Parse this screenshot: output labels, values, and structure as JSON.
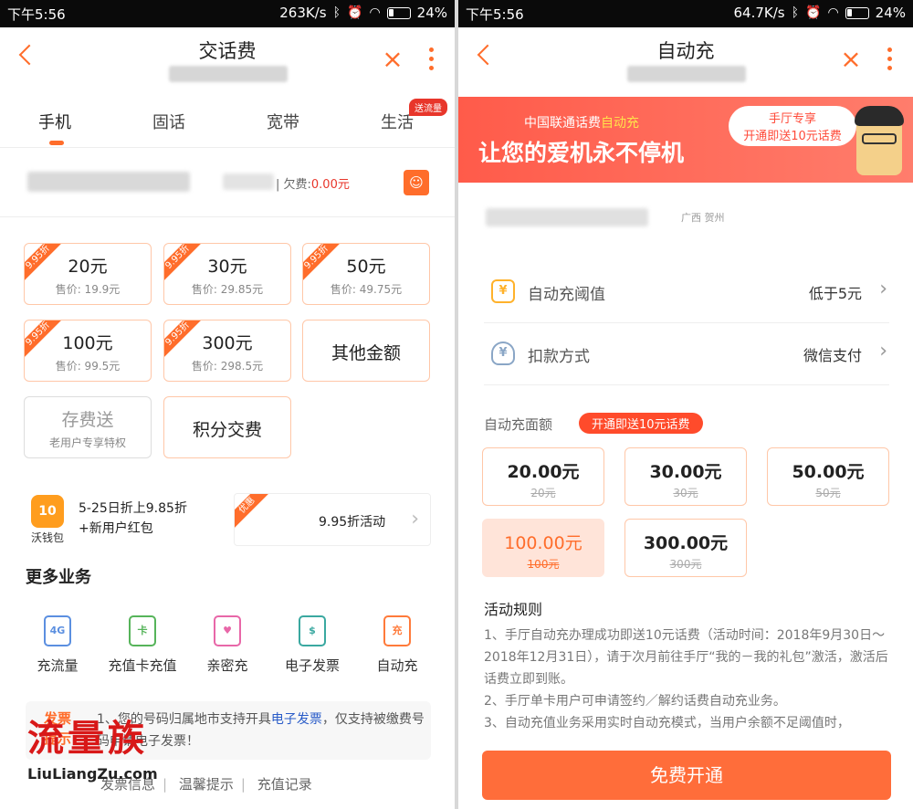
{
  "left": {
    "status": {
      "time": "下午5:56",
      "speed": "263K/s",
      "battery": "24%"
    },
    "nav": {
      "title": "交话费"
    },
    "tabs": [
      {
        "label": "手机"
      },
      {
        "label": "固话"
      },
      {
        "label": "宽带"
      },
      {
        "label": "生活",
        "badge": "送流量"
      }
    ],
    "phone": {
      "arrears_label": "欠费:",
      "arrears_value": "0.00元"
    },
    "cards": [
      {
        "amount": "20元",
        "price": "售价: 19.9元",
        "ribbon": "9.95折"
      },
      {
        "amount": "30元",
        "price": "售价: 29.85元",
        "ribbon": "9.95折"
      },
      {
        "amount": "50元",
        "price": "售价: 49.75元",
        "ribbon": "9.95折"
      },
      {
        "amount": "100元",
        "price": "售价: 99.5元",
        "ribbon": "9.95折"
      },
      {
        "amount": "300元",
        "price": "售价: 298.5元",
        "ribbon": "9.95折"
      },
      {
        "amount": "其他金额"
      },
      {
        "amount": "存费送",
        "price": "老用户专享特权"
      },
      {
        "amount": "积分交费"
      }
    ],
    "promo": {
      "wallet_label": "沃钱包",
      "wallet_glyph": "10",
      "line1": "5-25日折上9.85折",
      "line2": "+新用户红包",
      "box_corner": "优惠",
      "box_text": "9.95折活动"
    },
    "more_title": "更多业务",
    "services": [
      {
        "label": "充流量",
        "glyph": "4G",
        "color": "#5b8fe0"
      },
      {
        "label": "充值卡充值",
        "glyph": "卡",
        "color": "#56b45a"
      },
      {
        "label": "亲密充",
        "glyph": "♥",
        "color": "#e867a8"
      },
      {
        "label": "电子发票",
        "glyph": "$",
        "color": "#3aa8a0"
      },
      {
        "label": "自动充",
        "glyph": "充",
        "color": "#ff7a3a"
      }
    ],
    "notice": {
      "tag": "发票提示",
      "pre": "1、您的号码归属地市支持开具",
      "link": "电子发票",
      "post": "，仅支持被缴费号码申请电子发票！"
    },
    "links": [
      "发票信息",
      "温馨提示",
      "充值记录"
    ],
    "watermark": {
      "text": "流量族",
      "url": "LiuLiangZu.com"
    }
  },
  "right": {
    "status": {
      "time": "下午5:56",
      "speed": "64.7K/s",
      "battery": "24%"
    },
    "nav": {
      "title": "自动充"
    },
    "banner": {
      "sub_pre": "中国联通话费",
      "sub_hl": "自动充",
      "main": "让您的爱机永不停机",
      "bubble1": "手厅专享",
      "bubble2": "开通即送10元话费"
    },
    "address": "广西 贺州",
    "rows": [
      {
        "label": "自动充阈值",
        "value": "低于5元",
        "icon": "¥"
      },
      {
        "label": "扣款方式",
        "value": "微信支付",
        "icon": "¥"
      }
    ],
    "face_title": "自动充面额",
    "face_badge": "开通即送10元话费",
    "amounts": [
      {
        "amount": "20.00元",
        "orig": "20元"
      },
      {
        "amount": "30.00元",
        "orig": "30元"
      },
      {
        "amount": "50.00元",
        "orig": "50元"
      },
      {
        "amount": "100.00元",
        "orig": "100元",
        "selected": true
      },
      {
        "amount": "300.00元",
        "orig": "300元"
      }
    ],
    "rules_title": "活动规则",
    "rules": [
      "1、手厅自动充办理成功即送10元话费（活动时间：2018年9月30日～2018年12月31日），请于次月前往手厅“我的－我的礼包”激活，激活后话费立即到账。",
      "2、手厅单卡用户可申请签约／解约话费自动充业务。",
      "3、自动充值业务采用实时自动充模式，当用户余额不足阈值时，"
    ],
    "button": "免费开通"
  }
}
